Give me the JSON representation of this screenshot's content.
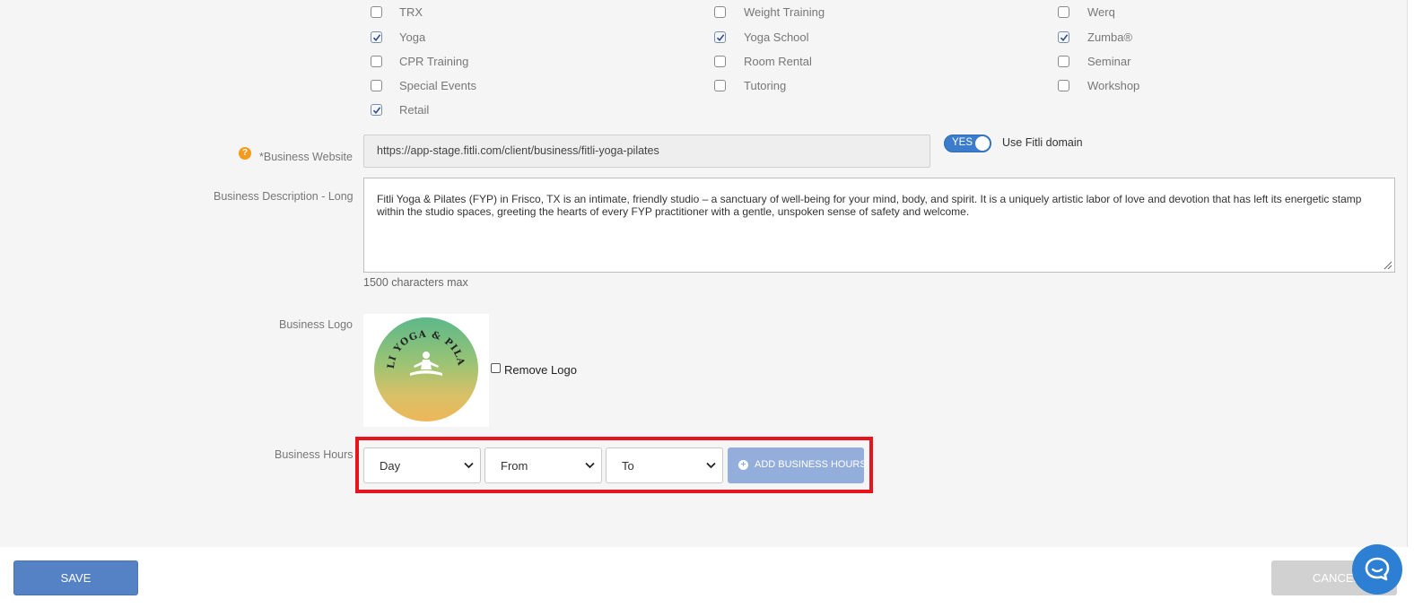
{
  "categories": {
    "items": [
      {
        "label": "TRX",
        "checked": false
      },
      {
        "label": "Weight Training",
        "checked": false
      },
      {
        "label": "Werq",
        "checked": false
      },
      {
        "label": "Yoga",
        "checked": true
      },
      {
        "label": "Yoga School",
        "checked": true
      },
      {
        "label": "Zumba®",
        "checked": true
      },
      {
        "label": "CPR Training",
        "checked": false
      },
      {
        "label": "Room Rental",
        "checked": false
      },
      {
        "label": "Seminar",
        "checked": false
      },
      {
        "label": "Special Events",
        "checked": false
      },
      {
        "label": "Tutoring",
        "checked": false
      },
      {
        "label": "Workshop",
        "checked": false
      },
      {
        "label": "Retail",
        "checked": true
      }
    ]
  },
  "website": {
    "help_icon": "?",
    "label": "*Business Website",
    "value": "https://app-stage.fitli.com/client/business/fitli-yoga-pilates",
    "toggle_text": "YES",
    "toggle_on": true,
    "toggle_label": "Use Fitli domain"
  },
  "description": {
    "label": "Business Description - Long",
    "value": "Fitli Yoga & Pilates (FYP) in Frisco, TX  is an intimate, friendly studio – a sanctuary of well-being for your mind, body, and spirit.  It is a uniquely artistic labor of love and devotion that has left its energetic stamp within the studio spaces, greeting the hearts of every FYP practitioner with a gentle, unspoken sense of safety and welcome.",
    "hint": "1500 characters max"
  },
  "logo": {
    "label": "Business Logo",
    "logo_text": "FITLI YOGA & PILATES",
    "remove_label": "Remove Logo",
    "remove_checked": false
  },
  "hours": {
    "label": "Business Hours",
    "day_selected": "Day",
    "from_selected": "From",
    "to_selected": "To",
    "add_label": "ADD BUSINESS HOURS"
  },
  "footer": {
    "save_label": "SAVE",
    "cancel_label": "CANCEL"
  },
  "colors": {
    "accent": "#5582c5",
    "highlight": "#e8141c",
    "help": "#f59b1c",
    "toggle": "#3b7ccc",
    "chat": "#2d7fd3"
  },
  "icons": [
    "help-icon",
    "checkmark-icon",
    "chevron-down-icon",
    "plus-circle-icon",
    "chat-icon",
    "meditation-icon",
    "resize-grip-icon"
  ]
}
